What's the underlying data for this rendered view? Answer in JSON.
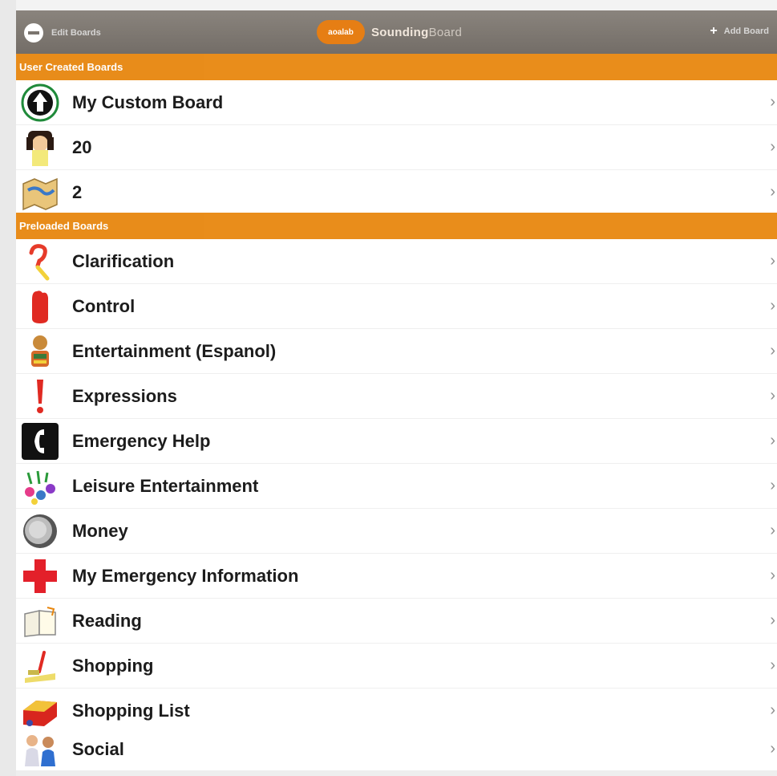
{
  "header": {
    "left_label": "Edit Boards",
    "brand_badge": "aoalab",
    "brand_name": "Sounding",
    "brand_suffix": "Board",
    "right_label": "Add Board"
  },
  "sections": {
    "user_created": "User Created Boards",
    "preloaded": "Preloaded Boards"
  },
  "user_boards": [
    {
      "label": "My Custom Board",
      "icon": "up-arrow-circle-icon"
    },
    {
      "label": "20",
      "icon": "person-icon"
    },
    {
      "label": "2",
      "icon": "map-icon"
    }
  ],
  "preloaded_boards": [
    {
      "label": "Clarification",
      "icon": "question-mark-icon"
    },
    {
      "label": "Control",
      "icon": "stop-hand-icon"
    },
    {
      "label": "Entertainment (Espanol)",
      "icon": "entertainment-icon"
    },
    {
      "label": "Expressions",
      "icon": "exclamation-icon"
    },
    {
      "label": "Emergency Help",
      "icon": "phone-icon"
    },
    {
      "label": "Leisure Entertainment",
      "icon": "leisure-icon"
    },
    {
      "label": "Money",
      "icon": "coin-icon"
    },
    {
      "label": "My Emergency Information",
      "icon": "red-cross-icon"
    },
    {
      "label": "Reading",
      "icon": "book-icon"
    },
    {
      "label": "Shopping",
      "icon": "shopping-icon"
    },
    {
      "label": "Shopping List",
      "icon": "shopping-list-icon"
    },
    {
      "label": "Social",
      "icon": "people-icon"
    }
  ],
  "chevron": "›",
  "colors": {
    "accent": "#e8870f",
    "titlebar": "#7b756f"
  }
}
